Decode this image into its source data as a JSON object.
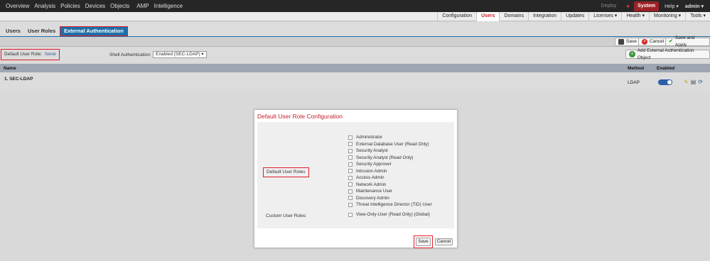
{
  "topnav": {
    "items": [
      "Overview",
      "Analysis",
      "Policies",
      "Devices",
      "Objects",
      "AMP",
      "Intelligence"
    ],
    "deploy": "Deploy",
    "system": "System",
    "help": "Help ▾",
    "admin": "admin ▾"
  },
  "subnav": {
    "items": [
      "Configuration",
      "Users",
      "Domains",
      "Integration",
      "Updates",
      "Licenses ▾",
      "Health ▾",
      "Monitoring ▾",
      "Tools ▾"
    ],
    "active": "Users"
  },
  "tabs": {
    "items": [
      "Users",
      "User Roles",
      "External Authentication"
    ],
    "active": "External Authentication"
  },
  "actions": {
    "save": "Save",
    "cancel": "Cancel",
    "save_apply": "Save and Apply",
    "add_object": "Add External Authentication Object"
  },
  "filters": {
    "default_role_label": "Default User Role:",
    "default_role_value": "None",
    "shell_label": "Shell Authentication",
    "shell_value": "Enabled (SEC-LDAP) ▾"
  },
  "table": {
    "headers": {
      "name": "Name",
      "method": "Method",
      "enabled": "Enabled"
    },
    "rows": [
      {
        "name": "1. SEC-LDAP",
        "method": "LDAP",
        "enabled": true
      }
    ]
  },
  "modal": {
    "title": "Default User Role Configuration",
    "default_roles_label": "Default User Roles",
    "default_roles": [
      "Administrator",
      "External Database User (Read Only)",
      "Security Analyst",
      "Security Analyst (Read Only)",
      "Security Approver",
      "Intrusion Admin",
      "Access Admin",
      "Network Admin",
      "Maintenance User",
      "Discovery Admin",
      "Threat Intelligence Director (TID) User"
    ],
    "custom_roles_label": "Custom User Roles",
    "custom_roles": [
      "View-Only-User (Read Only) (Global)"
    ],
    "save": "Save",
    "cancel": "Cancel"
  },
  "colors": {
    "brand_red": "#c41f2b",
    "highlight": "#e01b2b",
    "accent_blue": "#1f6fa8"
  }
}
